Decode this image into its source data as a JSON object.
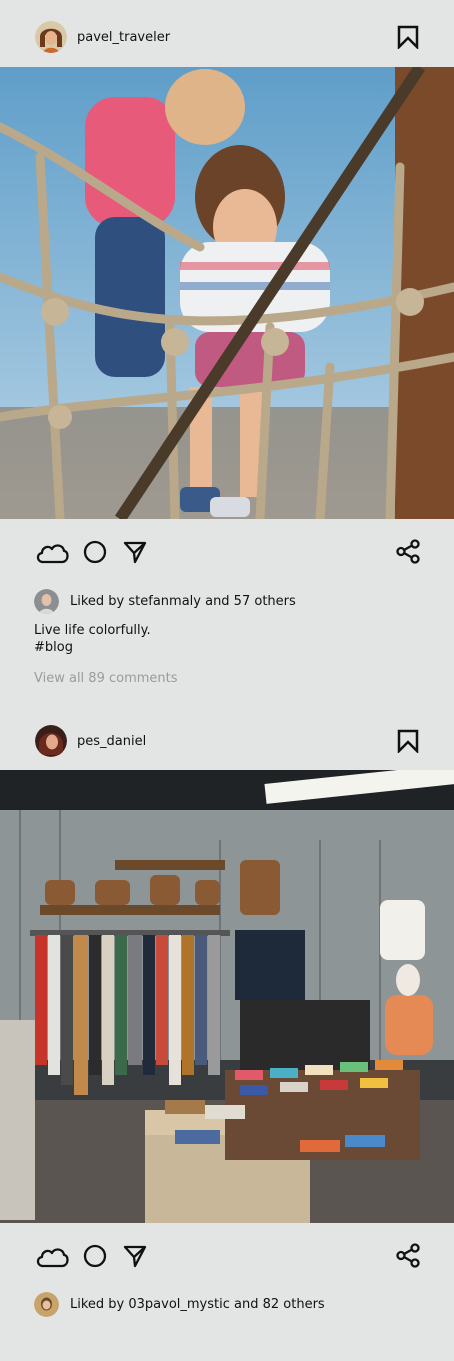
{
  "posts": [
    {
      "username": "pavel_traveler",
      "likes_text": "Liked by stefanmaly and 57 others",
      "caption": "Live life colorfully.",
      "hashtag": "#blog",
      "comments_link": "View all 89 comments",
      "image_alt": "Two girls climbing a rope net playground structure"
    },
    {
      "username": "pes_daniel",
      "likes_text": "Liked by 03pavol_mystic and 82 others",
      "image_alt": "Interior of a vintage thrift store with clothing racks and tables of folded items"
    }
  ],
  "icons": {
    "save": "bookmark-icon",
    "like": "cloud-icon",
    "comment": "circle-icon",
    "send": "send-icon",
    "share": "share-icon"
  },
  "colors": {
    "background": "#e3e5e4",
    "text": "#111111",
    "muted": "#9a9c9c"
  }
}
